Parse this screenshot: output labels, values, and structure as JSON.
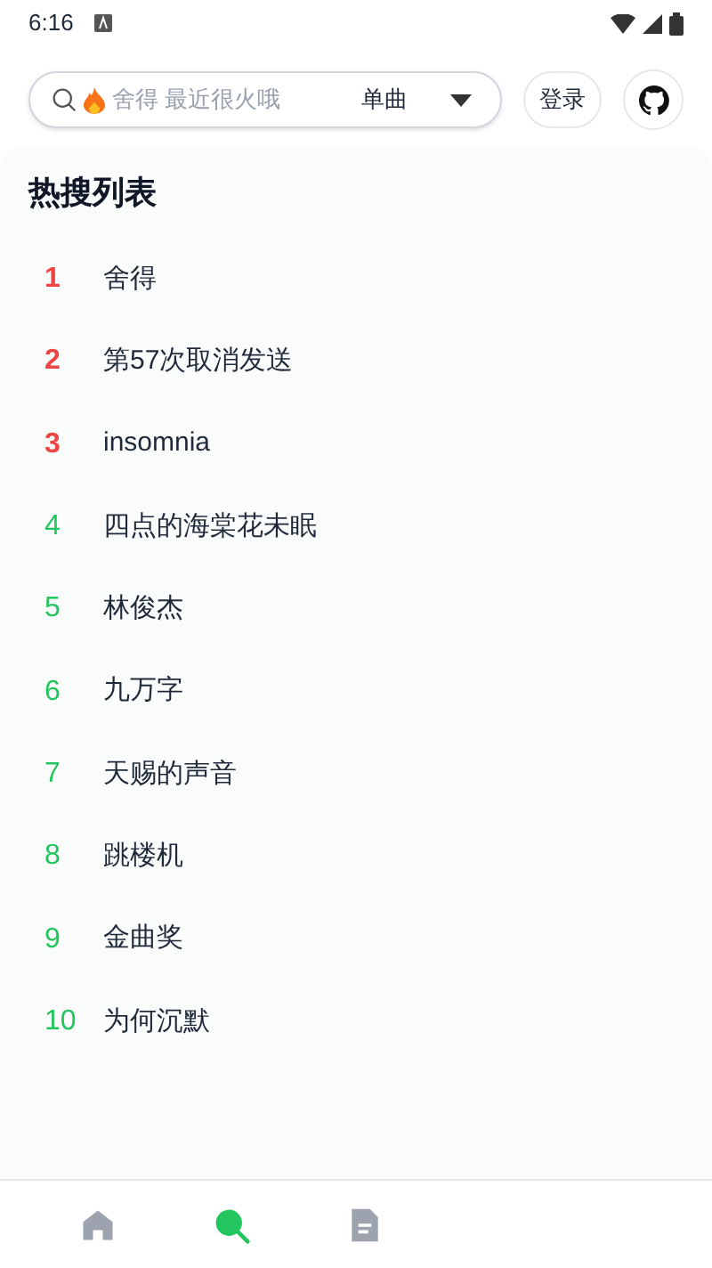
{
  "status_bar": {
    "time": "6:16"
  },
  "search": {
    "placeholder": "舍得 最近很火哦",
    "type": "单曲"
  },
  "login_button": "登录",
  "hot_list": {
    "title": "热搜列表",
    "items": [
      {
        "rank": "1",
        "name": "舍得",
        "color": "#ef4444"
      },
      {
        "rank": "2",
        "name": "第57次取消发送",
        "color": "#ef4444"
      },
      {
        "rank": "3",
        "name": "insomnia",
        "color": "#ef4444"
      },
      {
        "rank": "4",
        "name": "四点的海棠花未眠",
        "color": "#22c55e"
      },
      {
        "rank": "5",
        "name": "林俊杰",
        "color": "#22c55e"
      },
      {
        "rank": "6",
        "name": "九万字",
        "color": "#22c55e"
      },
      {
        "rank": "7",
        "name": "天赐的声音",
        "color": "#22c55e"
      },
      {
        "rank": "8",
        "name": "跳楼机",
        "color": "#22c55e"
      },
      {
        "rank": "9",
        "name": "金曲奖",
        "color": "#22c55e"
      },
      {
        "rank": "10",
        "name": "为何沉默",
        "color": "#22c55e"
      }
    ]
  },
  "bottom_nav": [
    {
      "kind": "home",
      "selected": false
    },
    {
      "kind": "search",
      "selected": true
    },
    {
      "kind": "document",
      "selected": false
    }
  ]
}
